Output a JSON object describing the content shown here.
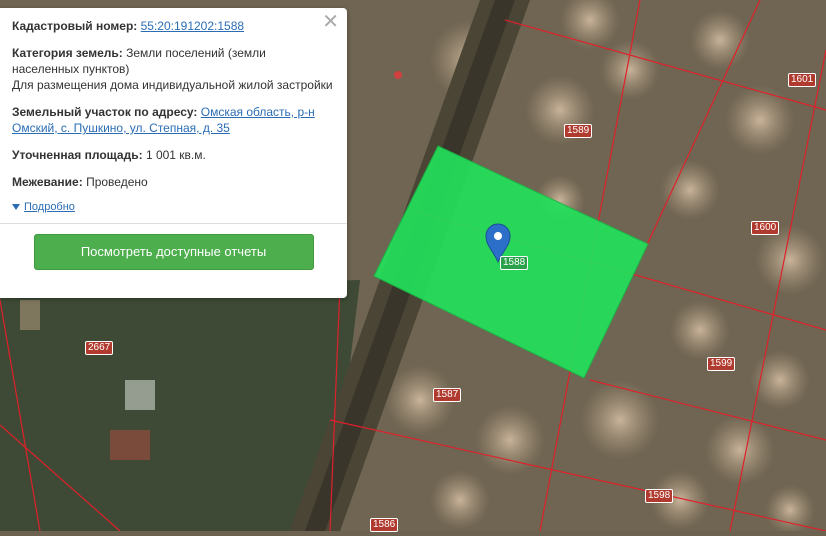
{
  "popup": {
    "cadastral_label": "Кадастровый номер:",
    "cadastral_value": "55:20:191202:1588",
    "category_label": "Категория земель:",
    "category_value": "Земли поселений (земли населенных пунктов)",
    "usage_value": "Для размещения дома индивидуальной жилой застройки",
    "address_label": "Земельный участок по адресу:",
    "address_value": "Омская область, р-н Омский, с. Пушкино, ул. Степная, д. 35",
    "area_label": "Уточненная площадь:",
    "area_value": "1 001 кв.м.",
    "survey_label": "Межевание:",
    "survey_value": "Проведено",
    "details_link": "Подробно",
    "reports_button": "Посмотреть доступные отчеты",
    "close_icon": "close-icon"
  },
  "map": {
    "plots": [
      {
        "label": "1601"
      },
      {
        "label": "1589"
      },
      {
        "label": "1600"
      },
      {
        "label": "1588"
      },
      {
        "label": "2667"
      },
      {
        "label": "1599"
      },
      {
        "label": "1587"
      },
      {
        "label": "1598"
      },
      {
        "label": "1586"
      }
    ],
    "highlight_color": "#22e05a",
    "boundary_color": "#e0202a",
    "marker_icon": "map-pin-icon"
  }
}
